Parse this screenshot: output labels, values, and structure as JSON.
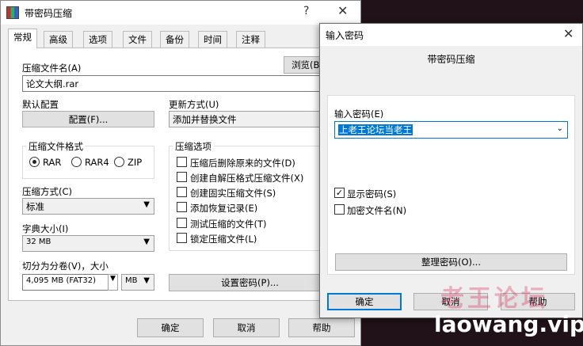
{
  "main_window": {
    "title": "带密码压缩",
    "help": "?",
    "close": "✕",
    "tabs": [
      "常规",
      "高级",
      "选项",
      "文件",
      "备份",
      "时间",
      "注释"
    ],
    "archive_name_label": "压缩文件名(A)",
    "archive_name_value": "论文大纲.rar",
    "browse_label": "浏览(B)",
    "default_config_label": "默认配置",
    "config_button": "配置(F)...",
    "update_mode_label": "更新方式(U)",
    "update_mode_value": "添加并替换文件",
    "format_group_title": "压缩文件格式",
    "formats": [
      "RAR",
      "RAR4",
      "ZIP"
    ],
    "selected_format": "RAR",
    "options_group_title": "压缩选项",
    "options": [
      {
        "label": "压缩后删除原来的文件(D)",
        "checked": false
      },
      {
        "label": "创建自解压格式压缩文件(X)",
        "checked": false
      },
      {
        "label": "创建固实压缩文件(S)",
        "checked": false
      },
      {
        "label": "添加恢复记录(E)",
        "checked": false
      },
      {
        "label": "测试压缩的文件(T)",
        "checked": false
      },
      {
        "label": "锁定压缩文件(L)",
        "checked": false
      }
    ],
    "method_label": "压缩方式(C)",
    "method_value": "标准",
    "dict_label": "字典大小(I)",
    "dict_value": "32 MB",
    "split_label": "切分为分卷(V)，大小",
    "split_value": "4,095 MB  (FAT32)",
    "split_unit": "MB",
    "set_password_button": "设置密码(P)...",
    "ok": "确定",
    "cancel": "取消",
    "help_button": "帮助"
  },
  "password_dialog": {
    "title": "输入密码",
    "close": "✕",
    "subtitle": "带密码压缩",
    "password_label": "输入密码(E)",
    "password_value": "上老王论坛当老王",
    "show_password_label": "显示密码(S)",
    "show_password_checked": true,
    "encrypt_names_label": "加密文件名(N)",
    "encrypt_names_checked": false,
    "organize_button": "整理密码(O)...",
    "ok": "确定",
    "cancel": "取消",
    "help_button": "帮助"
  },
  "watermark": {
    "cn": "老王论坛",
    "en": "laowang.vip"
  }
}
